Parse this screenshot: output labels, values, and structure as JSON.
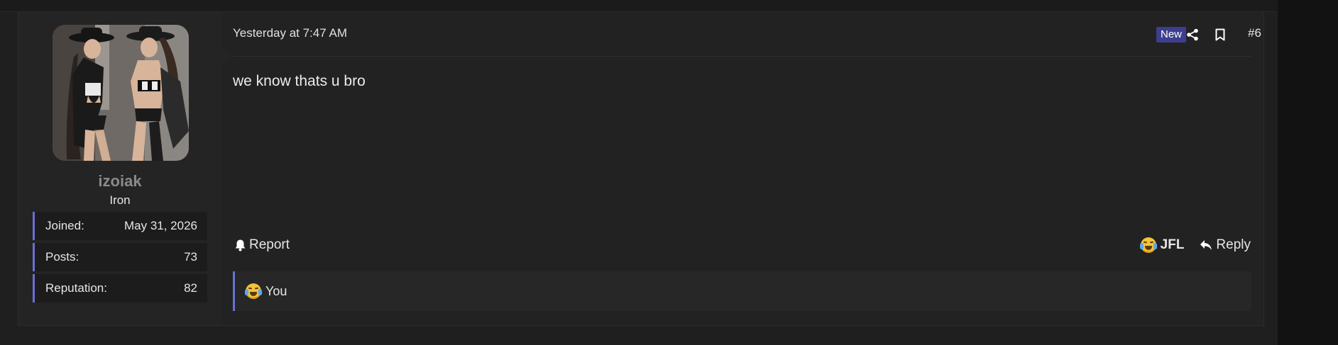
{
  "post": {
    "date": "Yesterday at 7:47 AM",
    "badge": "New",
    "number": "#6",
    "message": "we know thats u bro"
  },
  "user": {
    "name": "izoiak",
    "title": "Iron",
    "stats": [
      {
        "label": "Joined:",
        "value": "May 31, 2026"
      },
      {
        "label": "Posts:",
        "value": "73"
      },
      {
        "label": "Reputation:",
        "value": "82"
      }
    ]
  },
  "actions": {
    "report": "Report",
    "reaction": "JFL",
    "reply": "Reply"
  },
  "reactions": {
    "summary": "You"
  },
  "icons": {
    "share": "share-icon",
    "bookmark": "bookmark-icon",
    "report": "bell-icon",
    "reply": "reply-arrow-icon",
    "reaction": "joy-emoji-icon"
  },
  "colors": {
    "accent": "#6b6fd6",
    "badge_bg": "#3c3f8f",
    "username": "#8a8a8a"
  }
}
